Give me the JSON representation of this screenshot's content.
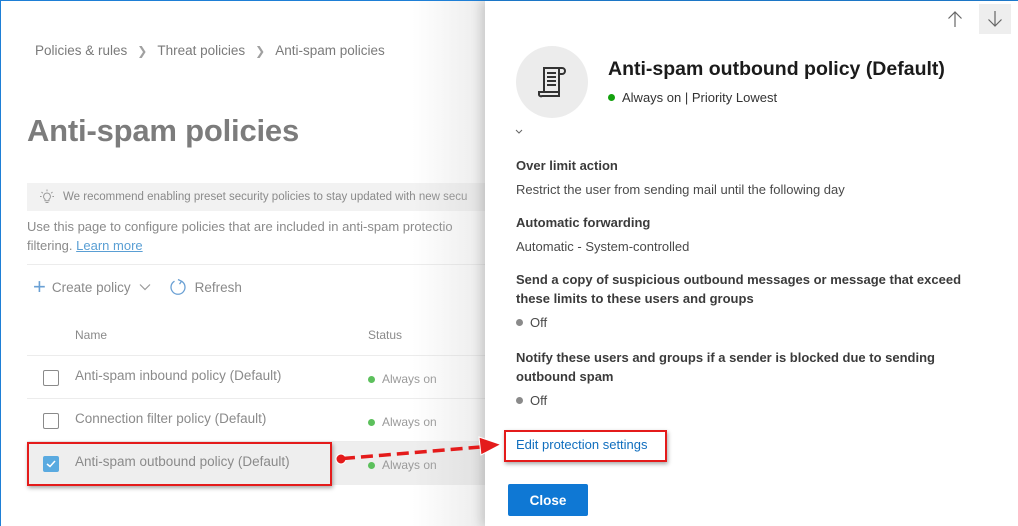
{
  "breadcrumb": [
    "Policies & rules",
    "Threat policies",
    "Anti-spam policies"
  ],
  "page": {
    "title": "Anti-spam policies",
    "banner_text": "We recommend enabling preset security policies to stay updated with new secu",
    "intro_line1": "Use this page to configure policies that are included in anti-spam protectio",
    "intro_line2": "filtering.",
    "learn_more": "Learn more"
  },
  "toolbar": {
    "create_policy": "Create policy",
    "refresh": "Refresh"
  },
  "table": {
    "columns": [
      "Name",
      "Status"
    ],
    "rows": [
      {
        "name": "Anti-spam inbound policy (Default)",
        "status": "Always on",
        "checked": false
      },
      {
        "name": "Connection filter policy (Default)",
        "status": "Always on",
        "checked": false
      },
      {
        "name": "Anti-spam outbound policy (Default)",
        "status": "Always on",
        "checked": true
      }
    ]
  },
  "panel": {
    "title": "Anti-spam outbound policy (Default)",
    "subtitle": "Always on | Priority Lowest",
    "status_color": "#13a10e",
    "fields": [
      {
        "label": "Over limit action",
        "value": "Restrict the user from sending mail until the following day"
      },
      {
        "label": "Automatic forwarding",
        "value": "Automatic - System-controlled"
      },
      {
        "label": "Send a copy of suspicious outbound messages or message that exceed these limits to these users and groups",
        "value": "Off"
      },
      {
        "label": "Notify these users and groups if a sender is blocked due to sending outbound spam",
        "value": "Off"
      }
    ],
    "edit_link": "Edit protection settings",
    "close_label": "Close"
  },
  "colors": {
    "accent": "#0f78d4",
    "annotation": "#e41b1b",
    "status_on": "#5cc05c"
  }
}
